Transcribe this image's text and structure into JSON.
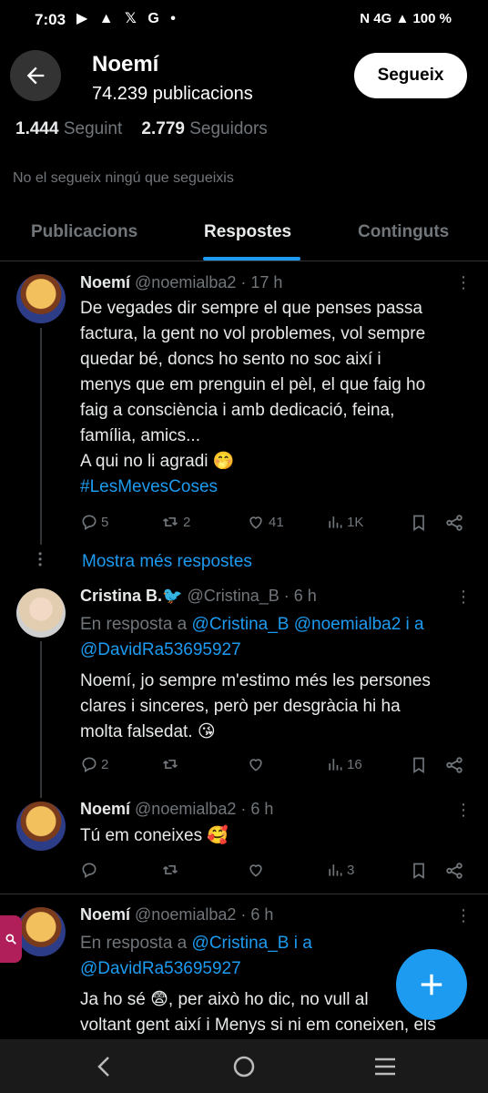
{
  "status_bar": {
    "time": "7:03",
    "left_icons": "▶ ▲ 𝕏 G •",
    "right_text": "N 4G ▲ 100 %"
  },
  "header": {
    "name": "Noemí",
    "posts": "74.239 publicacions",
    "follow_label": "Segueix"
  },
  "stats": {
    "following_count": "1.444",
    "following_label": "Seguint",
    "followers_count": "2.779",
    "followers_label": "Seguidors"
  },
  "note": "No el segueix ningú que segueixis",
  "tabs": [
    {
      "label": "Publicacions"
    },
    {
      "label": "Respostes"
    },
    {
      "label": "Continguts"
    }
  ],
  "tweets": [
    {
      "name": "Noemí",
      "handle": "@noemialba2 · 17 h",
      "lines": [
        "De vegades dir sempre el que penses passa",
        "factura, la gent no vol problemes, vol sempre",
        "quedar bé, doncs ho sento no soc així i",
        "menys que em prenguin el pèl, el que faig ho",
        "faig a consciència i amb dedicació, feina,",
        "família, amics...",
        "A qui no li agradi 🤭"
      ],
      "hashtag": "#LesMevesCoses",
      "replies": "5",
      "reposts": "2",
      "likes": "41",
      "views": "1K"
    },
    {
      "name": "Cristina B.🐦",
      "handle": "@Cristina_B · 6 h",
      "reply_prefix": "En resposta a ",
      "reply_mentions_1": "@Cristina_B @noemialba2 i a",
      "reply_mentions_2": "@DavidRa53695927",
      "lines": [
        "Noemí, jo sempre m'estimo més  les persones",
        "clares i sinceres, però per desgràcia hi ha",
        "molta falsedat. 😘"
      ],
      "replies": "2",
      "reposts": "",
      "likes": "",
      "views": "16"
    },
    {
      "name": "Noemí",
      "handle": "@noemialba2 · 6 h",
      "lines": [
        "Tú em coneixes 🥰"
      ],
      "replies": "",
      "reposts": "",
      "likes": "",
      "views": "3"
    },
    {
      "name": "Noemí",
      "handle": "@noemialba2 · 6 h",
      "reply_prefix": "En resposta a ",
      "reply_mentions_1": "@Cristina_B i a",
      "reply_mentions_2": "@DavidRa53695927",
      "lines": [
        "Ja ho sé 😨, per això ho dic, no vull al",
        "voltant gent així i Menys si ni em coneixen, els"
      ]
    }
  ],
  "show_more": "Mostra més respostes",
  "icons": {
    "back": "arrow-left-icon",
    "more": "more-vertical-icon",
    "reply": "reply-icon",
    "repost": "repost-icon",
    "like": "heart-icon",
    "views": "views-icon",
    "bookmark": "bookmark-icon",
    "share": "share-icon",
    "compose": "plus-icon"
  },
  "colors": {
    "accent": "#1d9bf0",
    "background": "#000000",
    "text": "#e7e9ea",
    "muted": "#71767b"
  }
}
